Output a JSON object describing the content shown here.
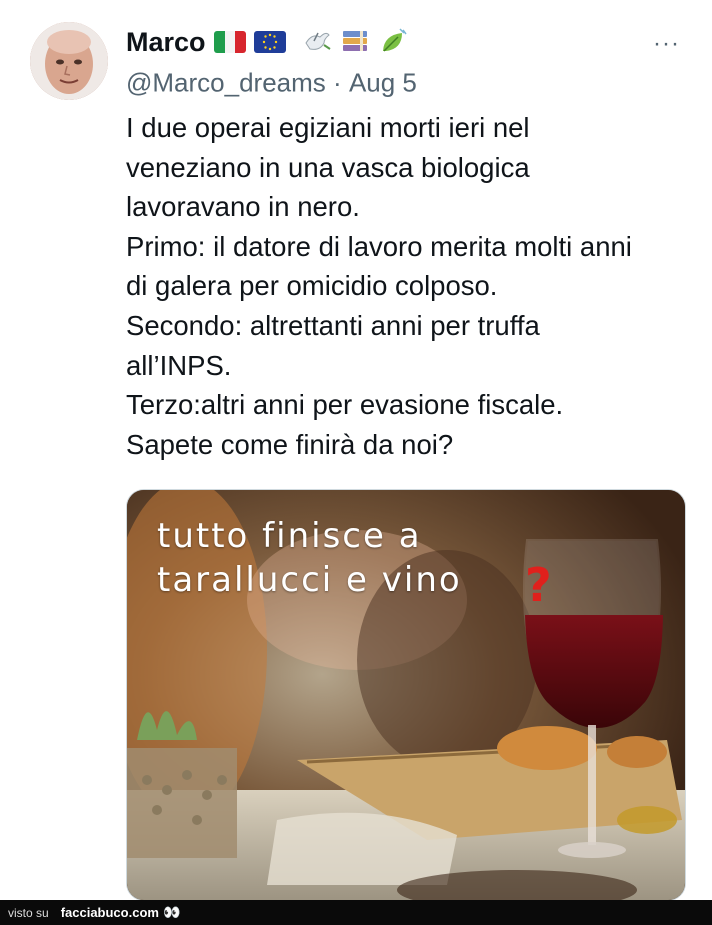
{
  "tweet": {
    "display_name": "Marco",
    "handle": "@Marco_dreams",
    "separator": "·",
    "date": "Aug 5",
    "more_label": "···",
    "name_emojis": [
      "italy-flag",
      "eu-flag",
      "dove",
      "books",
      "leaf"
    ],
    "text": "I due operai egiziani morti ieri nel\nveneziano in una vasca biologica\nlavoravano in nero.\nPrimo: il datore di lavoro merita molti anni\ndi galera per omicidio colposo.\nSecondo: altrettanti anni per truffa\nall’INPS.\nTerzo:altri anni per evasione fiscale.\nSapete come finirà da noi?"
  },
  "media": {
    "line1": "tutto finisce a",
    "line2": "tarallucci e vino",
    "question_mark": "?"
  },
  "footer": {
    "visto_su": "visto su",
    "site": "facciabuco.com",
    "eyes": "👀"
  },
  "colors": {
    "text": "#0f1419",
    "secondary": "#536471",
    "accent_red": "#e0201c"
  }
}
